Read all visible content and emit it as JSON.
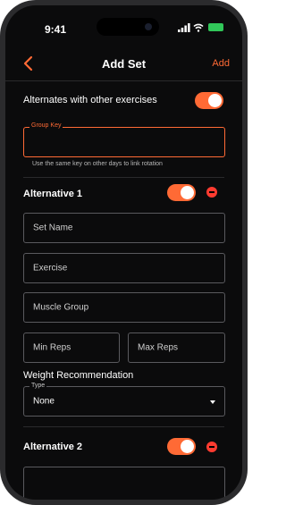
{
  "status": {
    "time": "9:41",
    "battery": ""
  },
  "nav": {
    "title": "Add Set",
    "add_label": "Add"
  },
  "alternates": {
    "label": "Alternates with other exercises",
    "on": true
  },
  "group_key": {
    "legend": "Group Key",
    "value": "",
    "helper": "Use the same key on other days to link rotation"
  },
  "alternative1": {
    "title": "Alternative 1",
    "enabled": true,
    "set_name_placeholder": "Set Name",
    "exercise_placeholder": "Exercise",
    "muscle_group_placeholder": "Muscle Group",
    "min_reps_placeholder": "Min Reps",
    "max_reps_placeholder": "Max Reps",
    "weight_recommendation_label": "Weight Recommendation",
    "type_legend": "Type",
    "type_value": "None"
  },
  "alternative2": {
    "title": "Alternative 2",
    "enabled": true
  },
  "colors": {
    "accent": "#ff6a35",
    "danger": "#ff3b30",
    "background": "#0b0b0c",
    "battery": "#31c759"
  }
}
